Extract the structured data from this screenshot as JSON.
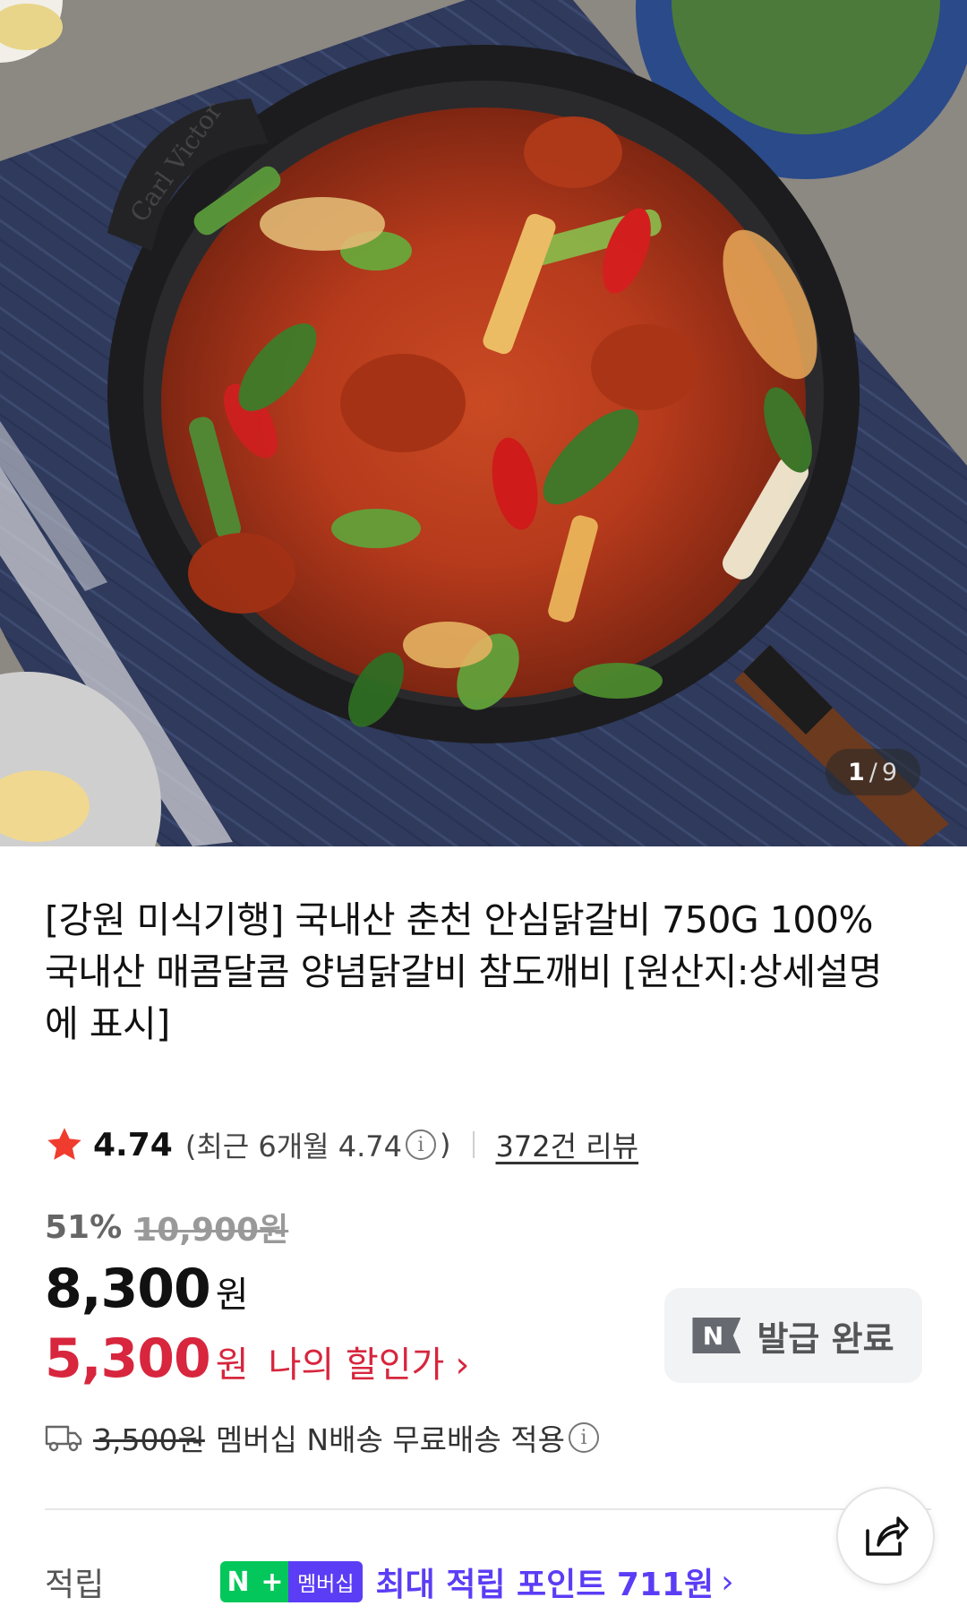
{
  "gallery": {
    "current": "1",
    "separator": "/",
    "total": "9",
    "pan_brand": "Carl Victor"
  },
  "product": {
    "title": "[강원 미식기행] 국내산 춘천 안심닭갈비 750G 100% 국내산 매콤달콤 양념닭갈비 참도깨비 [원산지:상세설명에 표시]"
  },
  "rating": {
    "score": "4.74",
    "recent_prefix": "(최근 6개월 4.74",
    "info_glyph": "i",
    "recent_suffix": ")",
    "reviews": "372건 리뷰"
  },
  "price": {
    "discount_rate": "51%",
    "original": "10,900원",
    "sale": "8,300",
    "sale_unit": "원",
    "my_price": "5,300",
    "my_unit": "원",
    "my_label": "나의 할인가",
    "chevron": "›",
    "coupon_badge": "N",
    "coupon_status": "발급 완료"
  },
  "shipping": {
    "original_fee": "3,500원",
    "text": "멤버십 N배송 무료배송 적용",
    "info_glyph": "i"
  },
  "points": {
    "label": "적립",
    "badge_n": "N",
    "badge_plus": "+",
    "badge_membership": "멤버십",
    "text": "최대 적립 포인트 711원",
    "chevron": "›"
  },
  "colors": {
    "sale_red": "#d7263d",
    "naver_green": "#03c75a",
    "membership_purple": "#5b3df5"
  },
  "icons": [
    "star-icon",
    "info-icon",
    "truck-icon",
    "share-icon",
    "chevron-right-icon"
  ]
}
